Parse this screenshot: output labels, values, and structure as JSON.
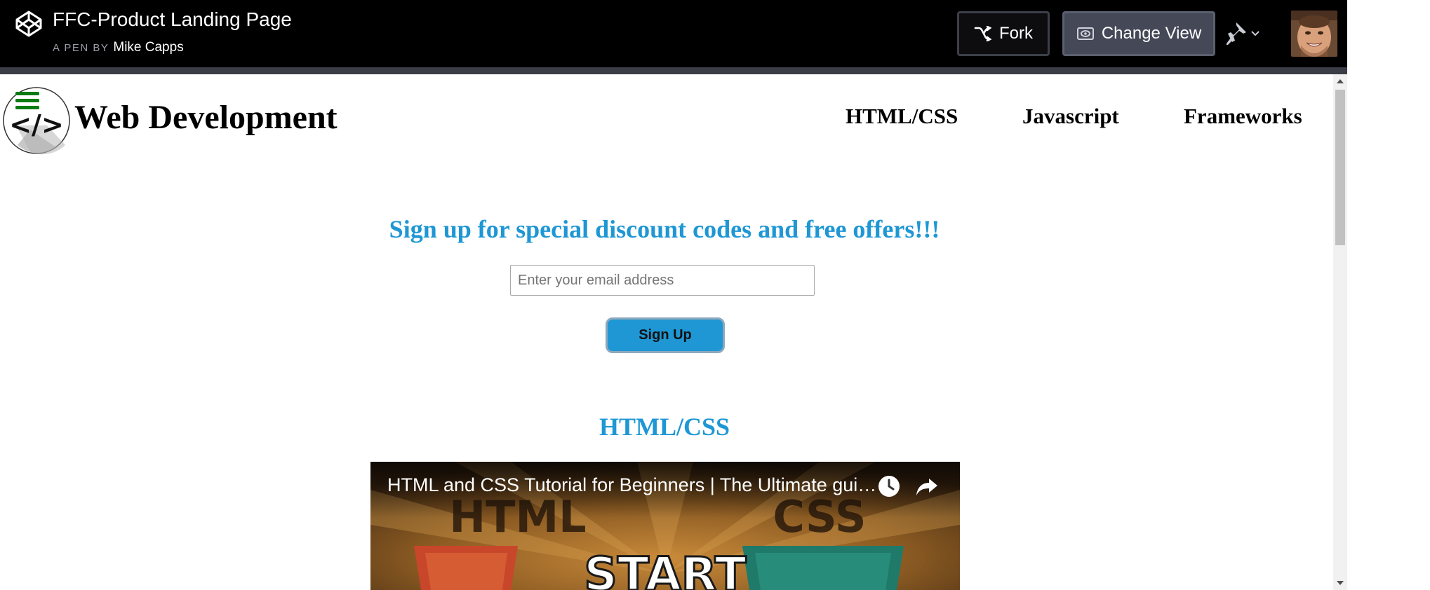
{
  "topbar": {
    "logo_icon": "codepen-logo-icon",
    "pen_title": "FFC-Product Landing Page",
    "byline_prefix": "A PEN BY",
    "author": "Mike Capps",
    "fork_label": "Fork",
    "fork_icon": "fork-icon",
    "change_view_label": "Change View",
    "change_view_icon": "eye-icon",
    "pin_icon": "pin-icon",
    "chevron_icon": "chevron-down-icon",
    "avatar_icon": "user-avatar"
  },
  "site": {
    "logo_glyph": "</>",
    "menu_icon": "hamburger-icon",
    "title": "Web Development",
    "nav": [
      "HTML/CSS",
      "Javascript",
      "Frameworks"
    ]
  },
  "signup": {
    "heading": "Sign up for special discount codes and free offers!!!",
    "email_placeholder": "Enter your email address",
    "button_label": "Sign Up"
  },
  "section": {
    "heading": "HTML/CSS"
  },
  "video": {
    "title": "HTML and CSS Tutorial for Beginners | The Ultimate gui…",
    "clock_icon": "watch-later-icon",
    "share_icon": "share-icon",
    "thumbnail_left": "HTML",
    "thumbnail_right": "CSS",
    "thumbnail_center": "START"
  },
  "colors": {
    "accent": "#1e97d4",
    "topbar_bg": "#000000",
    "change_view_bg": "#444857",
    "menu_green": "#0a7a12"
  }
}
